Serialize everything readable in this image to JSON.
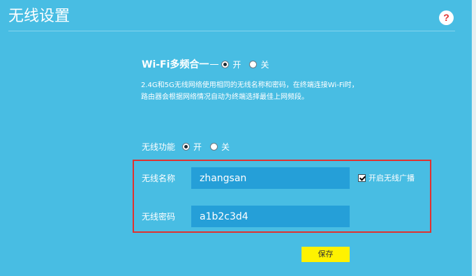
{
  "header": {
    "title": "无线设置",
    "help_icon": "help-icon",
    "help_glyph": "?"
  },
  "multiband": {
    "label": "Wi-Fi多频合一",
    "options": [
      {
        "label": "开",
        "checked": true
      },
      {
        "label": "关",
        "checked": false
      }
    ],
    "description_lines": [
      "2.4G和5G无线网络使用相同的无线名称和密码，在终端连接Wi-Fi时，",
      "路由器会根据网络情况自动为终端选择最佳上网频段。"
    ]
  },
  "wireless": {
    "function_label": "无线功能",
    "options": [
      {
        "label": "开",
        "checked": true
      },
      {
        "label": "关",
        "checked": false
      }
    ],
    "ssid_label": "无线名称",
    "ssid_value": "zhangsan",
    "broadcast_label": "开启无线广播",
    "broadcast_checked": true,
    "password_label": "无线密码",
    "password_value": "a1b2c3d4"
  },
  "actions": {
    "save_label": "保存"
  },
  "colors": {
    "background": "#48bde3",
    "input": "#259fd8",
    "highlight": "#e0322f",
    "save": "#fff200"
  }
}
